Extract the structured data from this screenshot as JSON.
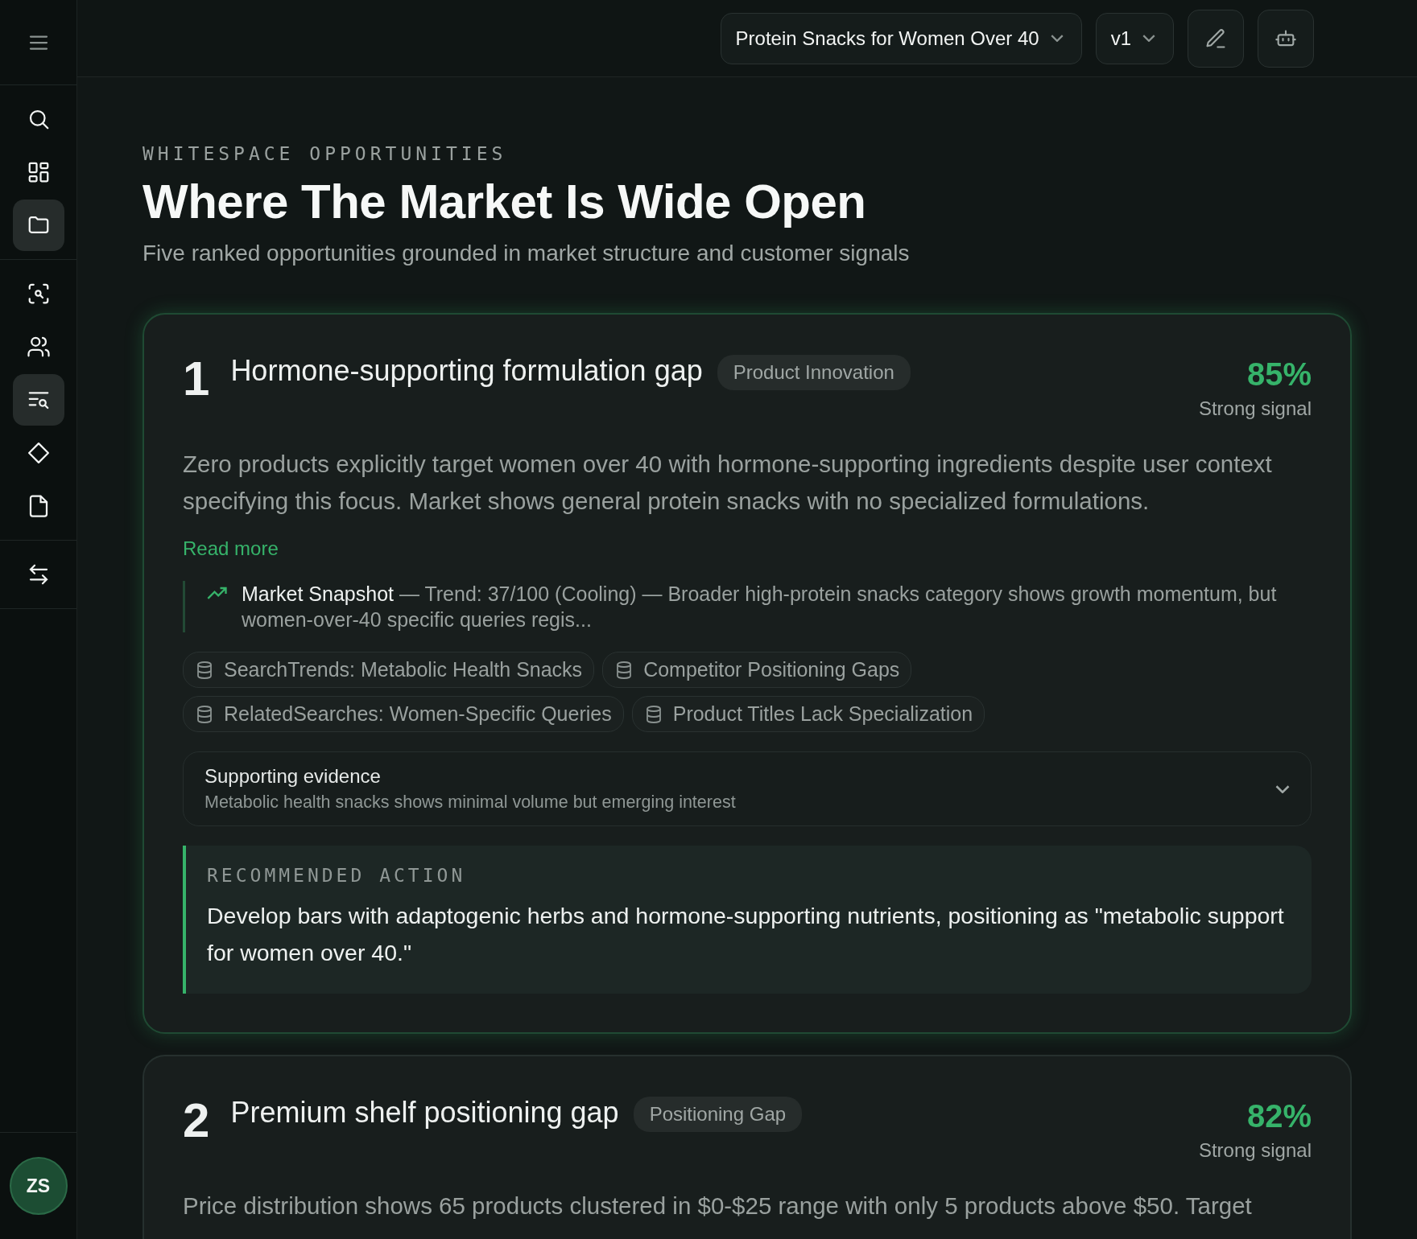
{
  "sidebar": {
    "groups": [
      [
        {
          "kind": "menu",
          "selected": false
        }
      ],
      [
        {
          "kind": "search",
          "selected": false
        },
        {
          "kind": "grid",
          "selected": false
        },
        {
          "kind": "folder",
          "selected": true
        }
      ],
      [
        {
          "kind": "scan",
          "selected": false
        },
        {
          "kind": "users",
          "selected": false
        },
        {
          "kind": "list-search",
          "selected": true
        },
        {
          "kind": "diamond",
          "selected": false
        },
        {
          "kind": "file",
          "selected": false
        }
      ],
      [
        {
          "kind": "swap",
          "selected": false
        }
      ]
    ],
    "avatar": "ZS"
  },
  "topbar": {
    "project": "Protein Snacks for Women Over 40",
    "version": "v1"
  },
  "header": {
    "eyebrow": "WHITESPACE OPPORTUNITIES",
    "title": "Where The Market Is Wide Open",
    "subtitle": "Five ranked opportunities grounded in market structure and customer signals"
  },
  "opportunities": [
    {
      "rank": "1",
      "title": "Hormone-supporting formulation gap",
      "tag": "Product Innovation",
      "score": "85%",
      "signal": "Strong signal",
      "selected": true,
      "description": "Zero products explicitly target women over 40 with hormone-supporting ingredients despite user context specifying this focus. Market shows general protein snacks with no specialized formulations.",
      "read_more": "Read more",
      "snapshot": {
        "label": "Market Snapshot",
        "text": "— Trend: 37/100 (Cooling) — Broader high-protein snacks category shows growth momentum, but women-over-40 specific queries regis..."
      },
      "sources": [
        "SearchTrends: Metabolic Health Snacks",
        "Competitor Positioning Gaps",
        "RelatedSearches: Women-Specific Queries",
        "Product Titles Lack Specialization"
      ],
      "evidence": {
        "title": "Supporting evidence",
        "text": "Metabolic health snacks shows minimal volume but emerging interest",
        "expanded": false
      },
      "action": {
        "label": "RECOMMENDED ACTION",
        "text": "Develop bars with adaptogenic herbs and hormone-supporting nutrients, positioning as \"metabolic support for women over 40.\""
      }
    },
    {
      "rank": "2",
      "title": "Premium shelf positioning gap",
      "tag": "Positioning Gap",
      "score": "82%",
      "signal": "Strong signal",
      "selected": false,
      "description": "Price distribution shows 65 products clustered in $0-$25 range with only 5 products above $50. Target"
    }
  ]
}
